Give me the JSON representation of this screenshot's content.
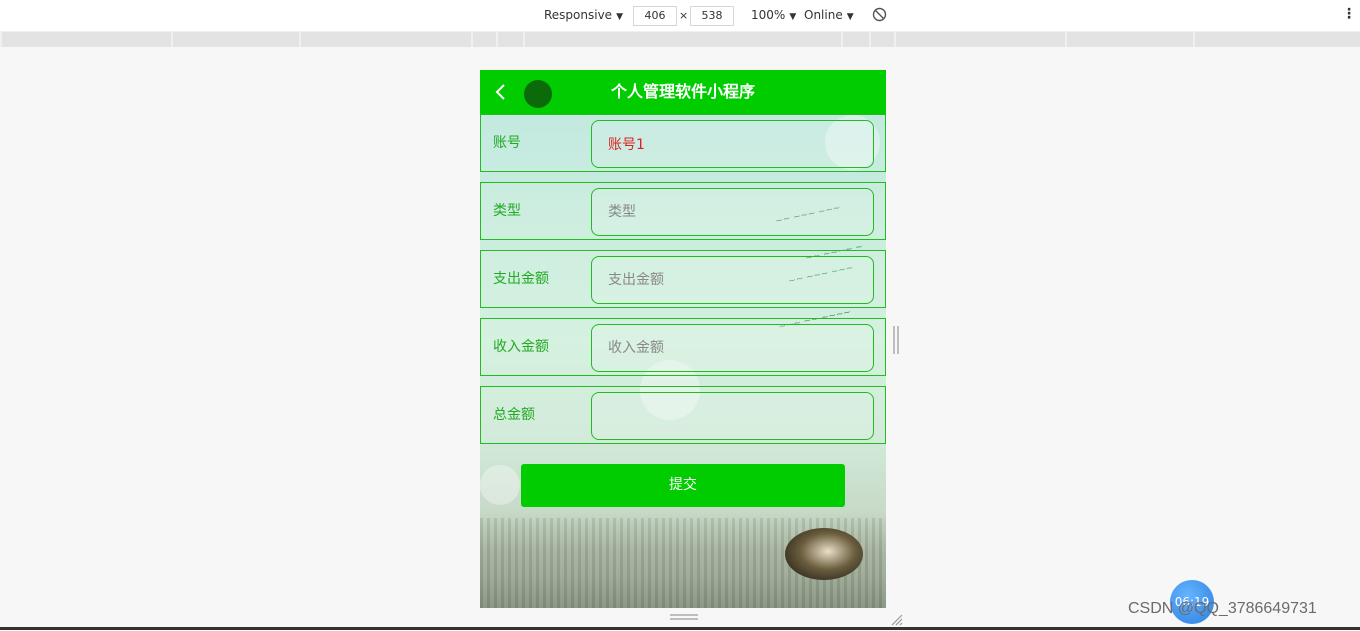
{
  "devtools": {
    "device_mode": "Responsive",
    "width": "406",
    "times": "×",
    "height": "538",
    "zoom": "100%",
    "network": "Online"
  },
  "app": {
    "title": "个人管理软件小程序",
    "accent": "#00cc00",
    "label_color": "#22aa22",
    "fields": [
      {
        "label": "账号",
        "value": "账号1",
        "placeholder": ""
      },
      {
        "label": "类型",
        "value": "",
        "placeholder": "类型"
      },
      {
        "label": "支出金额",
        "value": "",
        "placeholder": "支出金额"
      },
      {
        "label": "收入金额",
        "value": "",
        "placeholder": "收入金额"
      },
      {
        "label": "总金额",
        "value": "",
        "placeholder": ""
      }
    ],
    "submit_label": "提交"
  },
  "overlay": {
    "timer": "06:19",
    "watermark": "CSDN @QQ_3786649731"
  }
}
